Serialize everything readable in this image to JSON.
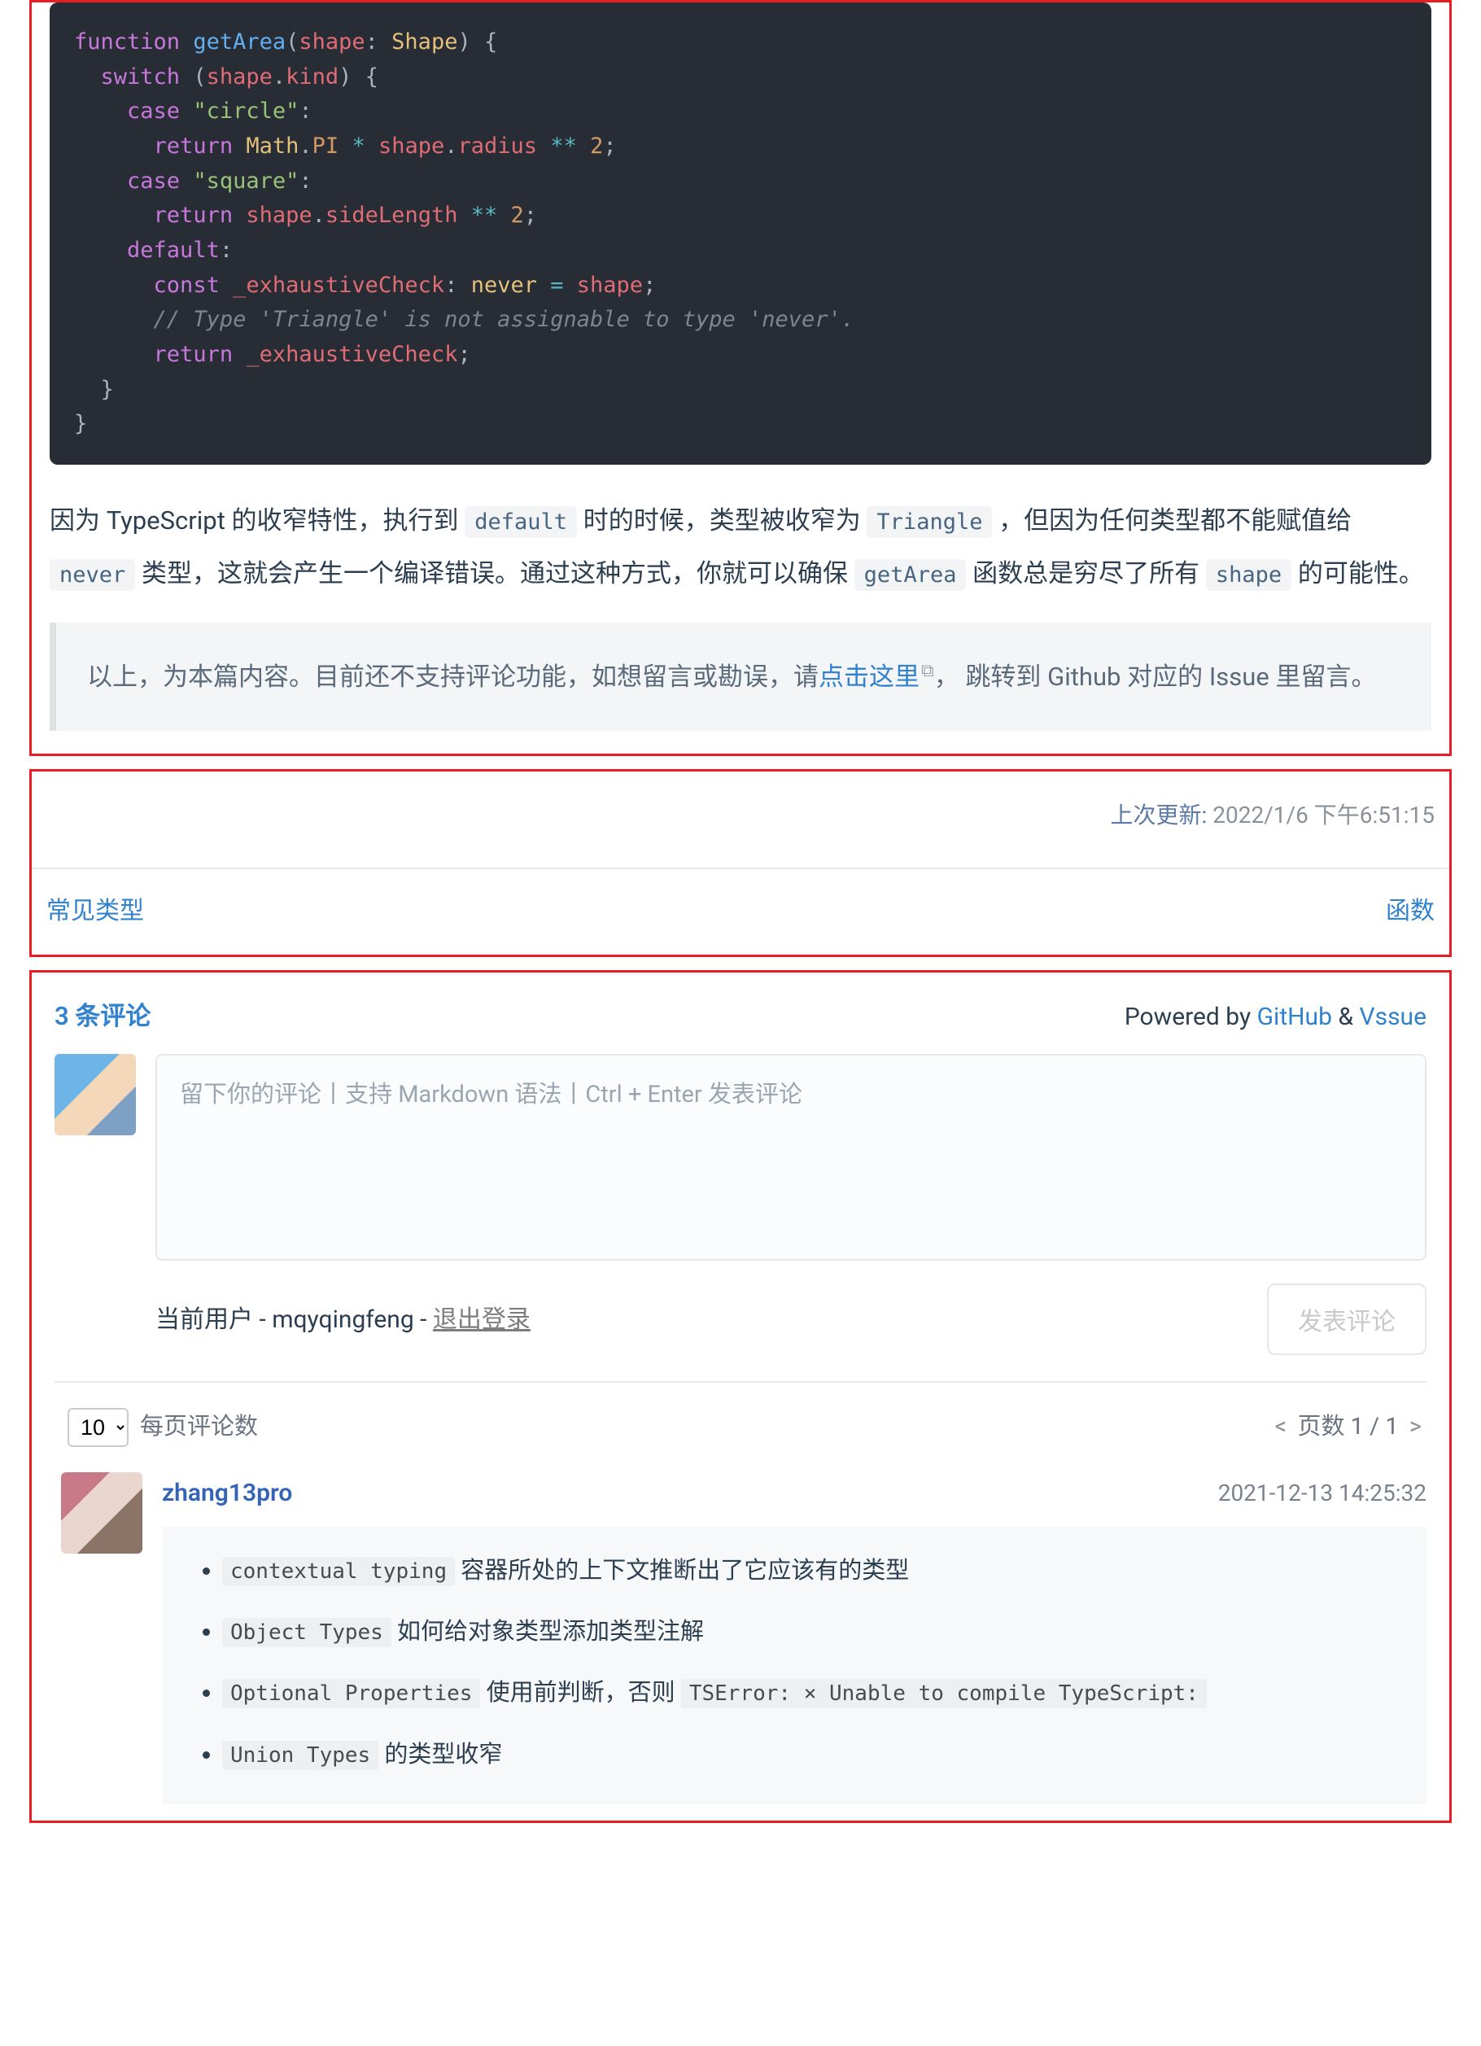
{
  "code": {
    "lines": [
      [
        [
          "kw",
          "function"
        ],
        [
          "sp",
          " "
        ],
        [
          "fn",
          "getArea"
        ],
        [
          "p",
          "("
        ],
        [
          "param",
          "shape"
        ],
        [
          "p",
          ": "
        ],
        [
          "type",
          "Shape"
        ],
        [
          "p",
          ") {"
        ]
      ],
      [
        [
          "indent",
          "  "
        ],
        [
          "kw",
          "switch"
        ],
        [
          "p",
          " ("
        ],
        [
          "param",
          "shape"
        ],
        [
          "p",
          "."
        ],
        [
          "prop",
          "kind"
        ],
        [
          "p",
          ") {"
        ]
      ],
      [
        [
          "indent",
          "    "
        ],
        [
          "kw",
          "case"
        ],
        [
          "sp",
          " "
        ],
        [
          "str",
          "\"circle\""
        ],
        [
          "p",
          ":"
        ]
      ],
      [
        [
          "indent",
          "      "
        ],
        [
          "kw",
          "return"
        ],
        [
          "sp",
          " "
        ],
        [
          "builtin",
          "Math"
        ],
        [
          "p",
          "."
        ],
        [
          "const",
          "PI"
        ],
        [
          "sp",
          " "
        ],
        [
          "op",
          "*"
        ],
        [
          "sp",
          " "
        ],
        [
          "param",
          "shape"
        ],
        [
          "p",
          "."
        ],
        [
          "prop",
          "radius"
        ],
        [
          "sp",
          " "
        ],
        [
          "op",
          "**"
        ],
        [
          "sp",
          " "
        ],
        [
          "num",
          "2"
        ],
        [
          "p",
          ";"
        ]
      ],
      [
        [
          "indent",
          "    "
        ],
        [
          "kw",
          "case"
        ],
        [
          "sp",
          " "
        ],
        [
          "str",
          "\"square\""
        ],
        [
          "p",
          ":"
        ]
      ],
      [
        [
          "indent",
          "      "
        ],
        [
          "kw",
          "return"
        ],
        [
          "sp",
          " "
        ],
        [
          "param",
          "shape"
        ],
        [
          "p",
          "."
        ],
        [
          "prop",
          "sideLength"
        ],
        [
          "sp",
          " "
        ],
        [
          "op",
          "**"
        ],
        [
          "sp",
          " "
        ],
        [
          "num",
          "2"
        ],
        [
          "p",
          ";"
        ]
      ],
      [
        [
          "indent",
          "    "
        ],
        [
          "kw",
          "default"
        ],
        [
          "p",
          ":"
        ]
      ],
      [
        [
          "indent",
          "      "
        ],
        [
          "kw",
          "const"
        ],
        [
          "sp",
          " "
        ],
        [
          "param",
          "_exhaustiveCheck"
        ],
        [
          "p",
          ": "
        ],
        [
          "type",
          "never"
        ],
        [
          "sp",
          " "
        ],
        [
          "op",
          "="
        ],
        [
          "sp",
          " "
        ],
        [
          "param",
          "shape"
        ],
        [
          "p",
          ";"
        ]
      ],
      [
        [
          "indent",
          "      "
        ],
        [
          "comment",
          "// Type 'Triangle' is not assignable to type 'never'."
        ]
      ],
      [
        [
          "indent",
          "      "
        ],
        [
          "kw",
          "return"
        ],
        [
          "sp",
          " "
        ],
        [
          "param",
          "_exhaustiveCheck"
        ],
        [
          "p",
          ";"
        ]
      ],
      [
        [
          "indent",
          "  "
        ],
        [
          "p",
          "}"
        ]
      ],
      [
        [
          "p",
          "}"
        ]
      ]
    ]
  },
  "para": {
    "p1_a": "因为 TypeScript 的收窄特性，执行到 ",
    "c1": "default",
    "p1_b": " 时的时候，类型被收窄为 ",
    "c2": "Triangle",
    "p1_c": " ，但因为任何类型都不能赋值给 ",
    "c3": "never",
    "p1_d": " 类型，这就会产生一个编译错误。通过这种方式，你就可以确保 ",
    "c4": "getArea",
    "p1_e": " 函数总是穷尽了所有 ",
    "c5": "shape",
    "p1_f": " 的可能性。"
  },
  "note": {
    "a": "以上，为本篇内容。目前还不支持评论功能，如想留言或勘误，请",
    "link": "点击这里",
    "b": "， 跳转到 Github 对应的 Issue 里留言。"
  },
  "meta": {
    "label": "上次更新:",
    "value": "2022/1/6 下午6:51:15"
  },
  "nav": {
    "prev": "常见类型",
    "next": "函数"
  },
  "comments": {
    "count_text": "3 条评论",
    "powered_prefix": "Powered by ",
    "powered_link1": "GitHub",
    "powered_amp": " & ",
    "powered_link2": "Vssue",
    "placeholder": "留下你的评论丨支持 Markdown 语法丨Ctrl + Enter 发表评论",
    "current_user_prefix": "当前用户 - ",
    "current_user": "mqyqingfeng",
    "dash": " - ",
    "logout": "退出登录",
    "submit": "发表评论",
    "per_page_value": "10",
    "per_page_label": "每页评论数",
    "pager_prefix": "页数 ",
    "pager_text": "1 / 1",
    "items": [
      {
        "author": "zhang13pro",
        "time": "2021-12-13 14:25:32",
        "bullets": [
          {
            "code": "contextual typing",
            "text": " 容器所处的上下文推断出了它应该有的类型"
          },
          {
            "code": "Object Types",
            "text": " 如何给对象类型添加类型注解"
          },
          {
            "code": "Optional Properties",
            "text": " 使用前判断，否则 ",
            "code2": "TSError: × Unable to compile TypeScript:"
          },
          {
            "code": "Union Types",
            "text": " 的类型收窄"
          }
        ]
      }
    ]
  }
}
